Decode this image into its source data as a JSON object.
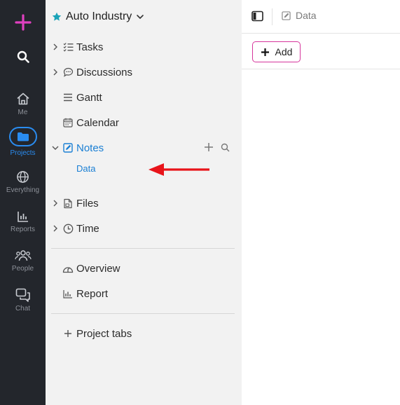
{
  "rail": {
    "items": [
      {
        "label": "Me"
      },
      {
        "label": "Projects"
      },
      {
        "label": "Everything"
      },
      {
        "label": "Reports"
      },
      {
        "label": "People"
      },
      {
        "label": "Chat"
      }
    ]
  },
  "sidebar": {
    "project_title": "Auto Industry",
    "items": [
      {
        "label": "Tasks"
      },
      {
        "label": "Discussions"
      },
      {
        "label": "Gantt"
      },
      {
        "label": "Calendar"
      },
      {
        "label": "Notes"
      },
      {
        "label": "Files"
      },
      {
        "label": "Time"
      },
      {
        "label": "Overview"
      },
      {
        "label": "Report"
      },
      {
        "label": "Project tabs"
      }
    ],
    "notes_sub": {
      "label": "Data"
    }
  },
  "main": {
    "breadcrumb": "Data",
    "add_label": "Add"
  },
  "colors": {
    "accent": "#1a7fd4",
    "brand": "#d6359c",
    "annotation_arrow": "#e8141a"
  }
}
